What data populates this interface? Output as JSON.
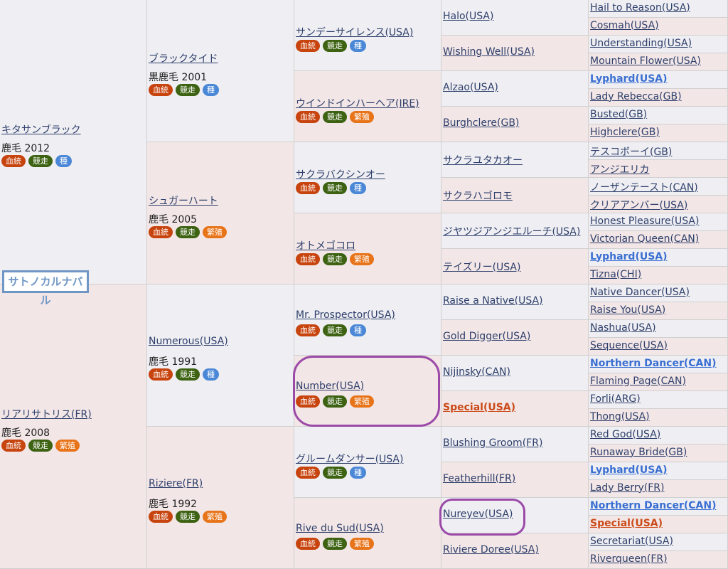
{
  "subject": "サトノカルナバル",
  "badge_labels": {
    "kettou": "血統",
    "kyouso": "競走",
    "shu": "種",
    "hanshoku": "繁殖"
  },
  "gen1": [
    {
      "name": "キタサンブラック",
      "info": "鹿毛 2012",
      "third": "shu"
    },
    {
      "name": "リアリサトリス(FR)",
      "info": "鹿毛 2008",
      "third": "hanshoku"
    }
  ],
  "gen2": [
    {
      "name": "ブラックタイド",
      "info": "黒鹿毛 2001",
      "third": "shu"
    },
    {
      "name": "シュガーハート",
      "info": "鹿毛 2005",
      "third": "hanshoku"
    },
    {
      "name": "Numerous(USA)",
      "info": "鹿毛 1991",
      "third": "shu"
    },
    {
      "name": "Riziere(FR)",
      "info": "鹿毛 1992",
      "third": "hanshoku"
    }
  ],
  "gen3": [
    {
      "name": "サンデーサイレンス(USA)",
      "third": "shu"
    },
    {
      "name": "ウインドインハーヘア(IRE)",
      "third": "hanshoku"
    },
    {
      "name": "サクラバクシンオー",
      "third": "shu"
    },
    {
      "name": "オトメゴコロ",
      "third": "hanshoku"
    },
    {
      "name": "Mr. Prospector(USA)",
      "third": "shu"
    },
    {
      "name": "Number(USA)",
      "third": "hanshoku"
    },
    {
      "name": "グルームダンサー(USA)",
      "third": "shu"
    },
    {
      "name": "Rive du Sud(USA)",
      "third": "hanshoku"
    }
  ],
  "gen4": [
    {
      "name": "Halo(USA)",
      "style": ""
    },
    {
      "name": "Wishing Well(USA)",
      "style": ""
    },
    {
      "name": "Alzao(USA)",
      "style": ""
    },
    {
      "name": "Burghclere(GB)",
      "style": ""
    },
    {
      "name": "サクラユタカオー",
      "style": ""
    },
    {
      "name": "サクラハゴロモ",
      "style": ""
    },
    {
      "name": "ジヤツジアンジエルーチ(USA)",
      "style": ""
    },
    {
      "name": "テイズリー(USA)",
      "style": ""
    },
    {
      "name": "Raise a Native(USA)",
      "style": ""
    },
    {
      "name": "Gold Digger(USA)",
      "style": ""
    },
    {
      "name": "Nijinsky(CAN)",
      "style": ""
    },
    {
      "name": "Special(USA)",
      "style": "orange"
    },
    {
      "name": "Blushing Groom(FR)",
      "style": ""
    },
    {
      "name": "Featherhill(FR)",
      "style": ""
    },
    {
      "name": "Nureyev(USA)",
      "style": ""
    },
    {
      "name": "Riviere Doree(USA)",
      "style": ""
    }
  ],
  "gen5": [
    {
      "name": "Hail to Reason(USA)",
      "style": ""
    },
    {
      "name": "Cosmah(USA)",
      "style": ""
    },
    {
      "name": "Understanding(USA)",
      "style": ""
    },
    {
      "name": "Mountain Flower(USA)",
      "style": ""
    },
    {
      "name": "Lyphard(USA)",
      "style": "blue"
    },
    {
      "name": "Lady Rebecca(GB)",
      "style": ""
    },
    {
      "name": "Busted(GB)",
      "style": ""
    },
    {
      "name": "Highclere(GB)",
      "style": ""
    },
    {
      "name": "テスコボーイ(GB)",
      "style": ""
    },
    {
      "name": "アンジエリカ",
      "style": ""
    },
    {
      "name": "ノーザンテースト(CAN)",
      "style": ""
    },
    {
      "name": "クリアアンバー(USA)",
      "style": ""
    },
    {
      "name": "Honest Pleasure(USA)",
      "style": ""
    },
    {
      "name": "Victorian Queen(CAN)",
      "style": ""
    },
    {
      "name": "Lyphard(USA)",
      "style": "blue"
    },
    {
      "name": "Tizna(CHI)",
      "style": ""
    },
    {
      "name": "Native Dancer(USA)",
      "style": ""
    },
    {
      "name": "Raise You(USA)",
      "style": ""
    },
    {
      "name": "Nashua(USA)",
      "style": ""
    },
    {
      "name": "Sequence(USA)",
      "style": ""
    },
    {
      "name": "Northern Dancer(CAN)",
      "style": "blue"
    },
    {
      "name": "Flaming Page(CAN)",
      "style": ""
    },
    {
      "name": "Forli(ARG)",
      "style": ""
    },
    {
      "name": "Thong(USA)",
      "style": ""
    },
    {
      "name": "Red God(USA)",
      "style": ""
    },
    {
      "name": "Runaway Bride(GB)",
      "style": ""
    },
    {
      "name": "Lyphard(USA)",
      "style": "blue"
    },
    {
      "name": "Lady Berry(FR)",
      "style": ""
    },
    {
      "name": "Northern Dancer(CAN)",
      "style": "blue"
    },
    {
      "name": "Special(USA)",
      "style": "orange"
    },
    {
      "name": "Secretariat(USA)",
      "style": ""
    },
    {
      "name": "Riverqueen(FR)",
      "style": ""
    }
  ]
}
